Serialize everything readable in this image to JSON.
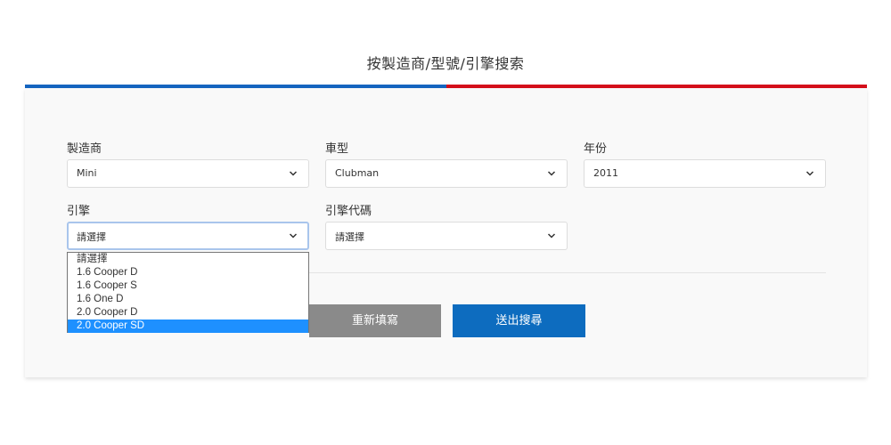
{
  "page": {
    "title": "按製造商/型號/引擎搜索"
  },
  "colors": {
    "accent_blue": "#1565c0",
    "accent_red": "#d50f1a",
    "submit_blue": "#0d6cbf",
    "reset_gray": "#8a8a8a",
    "option_highlight": "#1e90ff"
  },
  "form": {
    "manufacturer": {
      "label": "製造商",
      "value": "Mini"
    },
    "model": {
      "label": "車型",
      "value": "Clubman"
    },
    "year": {
      "label": "年份",
      "value": "2011"
    },
    "engine": {
      "label": "引擎",
      "value": "請選擇"
    },
    "engine_code": {
      "label": "引擎代碼",
      "value": "請選擇"
    }
  },
  "engine_dropdown": {
    "options": [
      "請選擇",
      "1.6 Cooper D",
      "1.6 Cooper S",
      "1.6 One D",
      "2.0 Cooper D",
      "2.0 Cooper SD"
    ],
    "highlighted": "2.0 Cooper SD"
  },
  "buttons": {
    "reset_label": "重新填寫",
    "submit_label": "送出搜尋"
  },
  "icons": {
    "select_arrow": "chevron-down-icon"
  }
}
